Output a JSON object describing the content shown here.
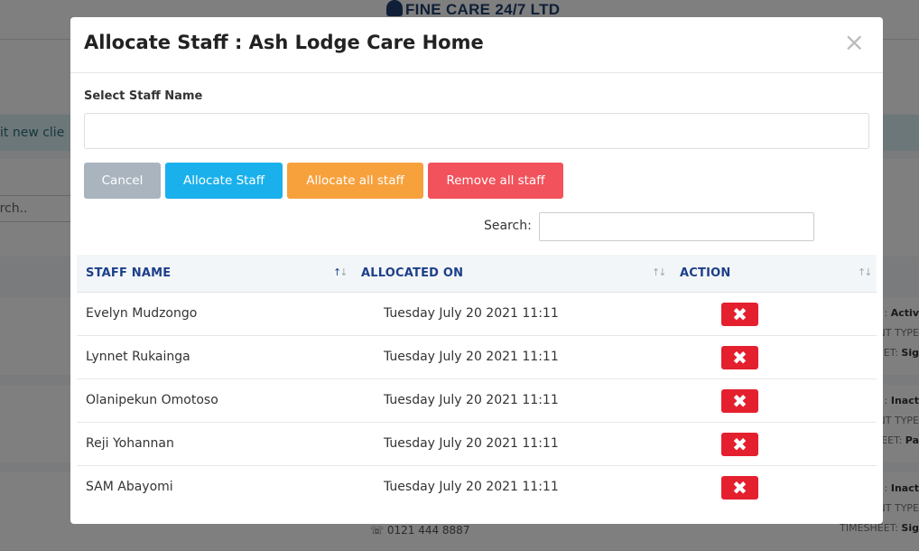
{
  "background": {
    "logo_text": "FINE CARE 24/7 LTD",
    "alert_text": "it new clie",
    "search_placeholder": "arch..",
    "phone": "0121 444 8887",
    "rows": [
      {
        "status_label": ": ",
        "status_value": "Activ",
        "type_label": "NT TYPE",
        "timesheet_label": "EET: ",
        "timesheet_value": "Sig"
      },
      {
        "status_label": ": ",
        "status_value": "Inact",
        "type_label": "NT TYPE",
        "timesheet_label": "EET: ",
        "timesheet_value": "Pa"
      },
      {
        "status_label": ": ",
        "status_value": "Inact",
        "type_label": "NT TYPE",
        "timesheet_label": "TIMESHEET: ",
        "timesheet_value": "Sig"
      }
    ]
  },
  "modal": {
    "title": "Allocate Staff : Ash Lodge Care Home",
    "close_glyph": "×",
    "staff_field_label": "Select Staff Name",
    "staff_field_value": "",
    "buttons": {
      "cancel": "Cancel",
      "allocate": "Allocate Staff",
      "allocate_all": "Allocate all staff",
      "remove_all": "Remove all staff"
    },
    "search_label": "Search:",
    "search_value": "",
    "table": {
      "columns": [
        "STAFF NAME",
        "ALLOCATED ON",
        "ACTION"
      ],
      "rows": [
        {
          "name": "Evelyn Mudzongo",
          "allocated_on": "Tuesday July 20 2021 11:11"
        },
        {
          "name": "Lynnet Rukainga",
          "allocated_on": "Tuesday July 20 2021 11:11"
        },
        {
          "name": "Olanipekun Omotoso",
          "allocated_on": "Tuesday July 20 2021 11:11"
        },
        {
          "name": "Reji Yohannan",
          "allocated_on": "Tuesday July 20 2021 11:11"
        },
        {
          "name": "SAM Abayomi",
          "allocated_on": "Tuesday July 20 2021 11:11"
        }
      ],
      "delete_glyph": "✖"
    }
  },
  "colors": {
    "primary_blue": "#1ab0ec",
    "orange": "#f7a13d",
    "red": "#f2525c",
    "delete_red": "#e4202f",
    "header_blue": "#1d3f8a"
  }
}
